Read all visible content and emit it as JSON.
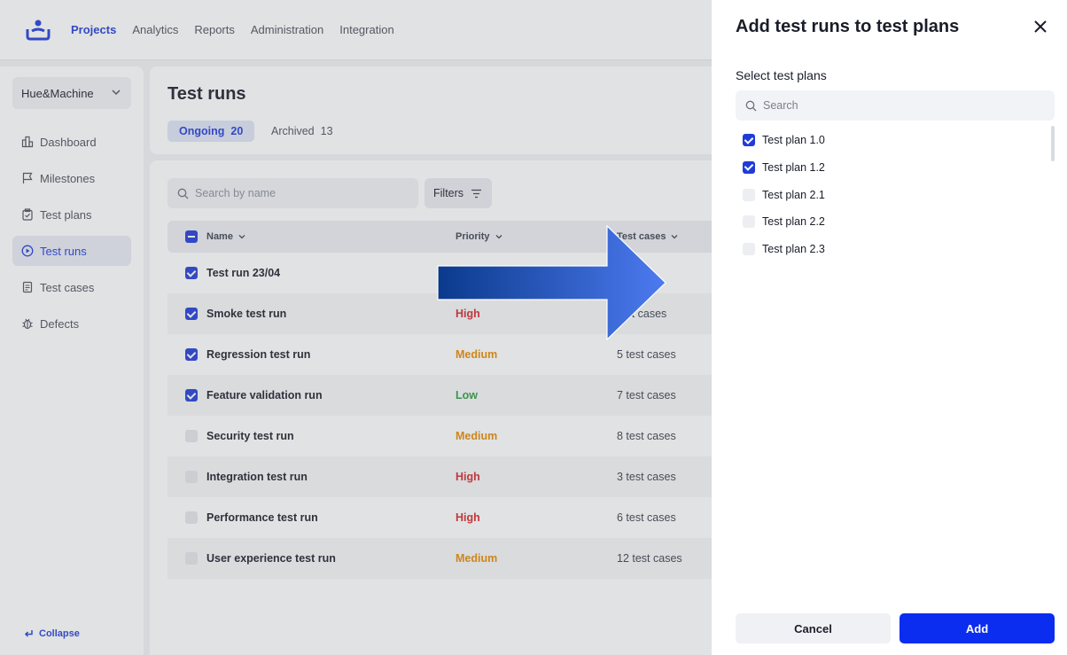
{
  "topnav": {
    "items": [
      "Projects",
      "Analytics",
      "Reports",
      "Administration",
      "Integration"
    ],
    "active": "Projects"
  },
  "sidebar": {
    "project": "Hue&Machine",
    "items": [
      {
        "label": "Dashboard",
        "icon": "dashboard-icon"
      },
      {
        "label": "Milestones",
        "icon": "flag-icon"
      },
      {
        "label": "Test plans",
        "icon": "clipboard-icon"
      },
      {
        "label": "Test runs",
        "icon": "play-circle-icon"
      },
      {
        "label": "Test cases",
        "icon": "document-icon"
      },
      {
        "label": "Defects",
        "icon": "bug-icon"
      }
    ],
    "active": "Test runs",
    "collapse_label": "Collapse"
  },
  "page": {
    "title": "Test runs",
    "tabs": [
      {
        "label": "Ongoing",
        "count": "20"
      },
      {
        "label": "Archived",
        "count": "13"
      }
    ]
  },
  "toolbar": {
    "search_placeholder": "Search by name",
    "filters_label": "Filters"
  },
  "table": {
    "columns": [
      "Name",
      "Priority",
      "Test cases"
    ],
    "rows": [
      {
        "name": "Test run 23/04",
        "priority": "",
        "test_cases": "cases",
        "checked": true
      },
      {
        "name": "Smoke test run",
        "priority": "High",
        "test_cases": "test cases",
        "checked": true
      },
      {
        "name": "Regression test run",
        "priority": "Medium",
        "test_cases": "5 test cases",
        "checked": true
      },
      {
        "name": "Feature validation run",
        "priority": "Low",
        "test_cases": "7 test cases",
        "checked": true
      },
      {
        "name": "Security test run",
        "priority": "Medium",
        "test_cases": "8 test cases",
        "checked": false
      },
      {
        "name": "Integration test run",
        "priority": "High",
        "test_cases": "3 test cases",
        "checked": false
      },
      {
        "name": "Performance test run",
        "priority": "High",
        "test_cases": "6 test cases",
        "checked": false
      },
      {
        "name": "User experience test run",
        "priority": "Medium",
        "test_cases": "12 test cases",
        "checked": false
      }
    ]
  },
  "drawer": {
    "title": "Add test runs to test plans",
    "section_label": "Select test plans",
    "search_placeholder": "Search",
    "plans": [
      {
        "label": "Test plan 1.0",
        "checked": true
      },
      {
        "label": "Test plan 1.2",
        "checked": true
      },
      {
        "label": "Test plan 2.1",
        "checked": false
      },
      {
        "label": "Test plan 2.2",
        "checked": false
      },
      {
        "label": "Test plan 2.3",
        "checked": false
      }
    ],
    "cancel_label": "Cancel",
    "add_label": "Add"
  },
  "colors": {
    "accent": "#1f3cd9",
    "add_button": "#0a2df0",
    "high": "#d4272c",
    "medium": "#e68a00",
    "low": "#2e9c3f",
    "arrow_start": "#0a3a8c",
    "arrow_end": "#4d7af0"
  }
}
